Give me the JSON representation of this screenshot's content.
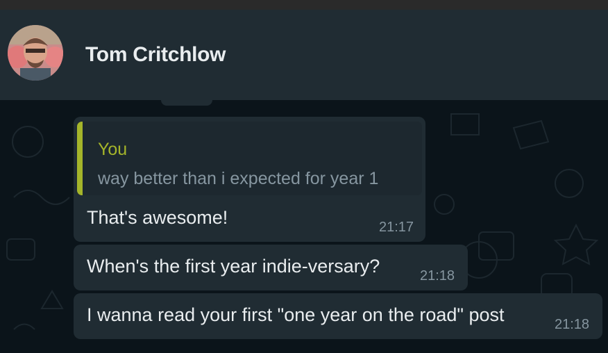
{
  "window": {
    "contact_name": "Tom Critchlow"
  },
  "quoted_message": {
    "author": "You",
    "text": "way better than i expected for year 1"
  },
  "messages": [
    {
      "text": "That's awesome!",
      "time": "21:17"
    },
    {
      "text": "When's the first year indie-versary?",
      "time": "21:18"
    },
    {
      "text": "I wanna read your first \"one year on the road\" post",
      "time": "21:18"
    }
  ],
  "colors": {
    "header_bg": "#202c33",
    "chat_bg": "#0b141a",
    "bubble_bg": "#202c33",
    "quote_accent": "#a5b52a",
    "text": "#e9edef",
    "meta_text": "#8696a0"
  }
}
